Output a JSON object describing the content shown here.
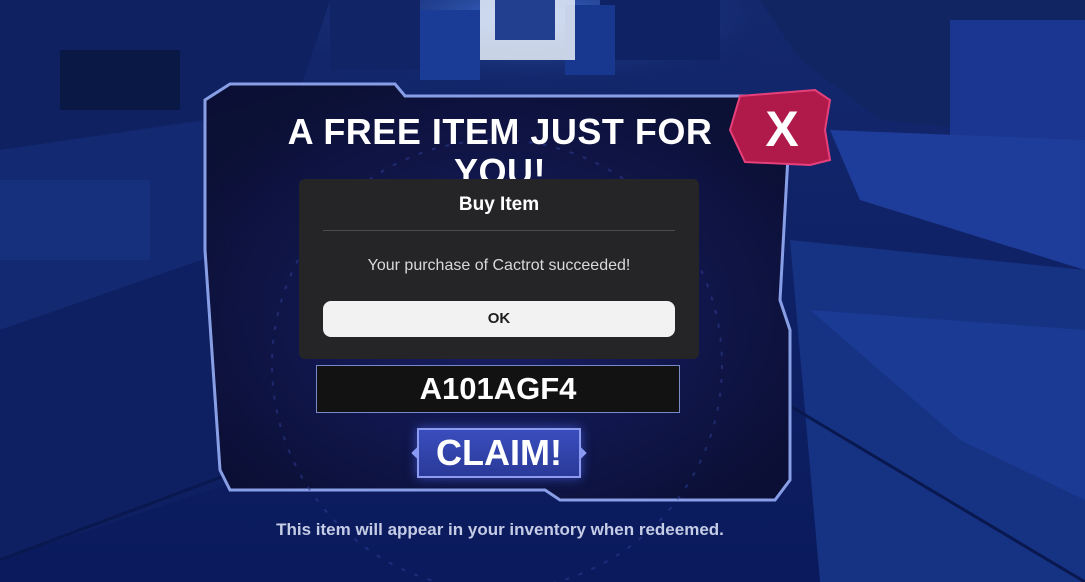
{
  "colors": {
    "background": "#0b1a52",
    "panel_fill": "#0e1238",
    "panel_border": "#8fa6ee",
    "close_accent": "#b01a4a",
    "dialog_bg": "#252528",
    "ok_bg": "#f2f2f2",
    "claim_bg": "#3a4dbd"
  },
  "redeem_panel": {
    "title": "A FREE ITEM JUST FOR YOU!",
    "close_label": "X",
    "code_value": "A101AGF4",
    "claim_label": "CLAIM!",
    "footnote": "This item will appear in your inventory when redeemed."
  },
  "dialog": {
    "title": "Buy Item",
    "message": "Your purchase of Cactrot succeeded!",
    "ok_label": "OK"
  },
  "icons": {
    "close": "x-icon"
  }
}
